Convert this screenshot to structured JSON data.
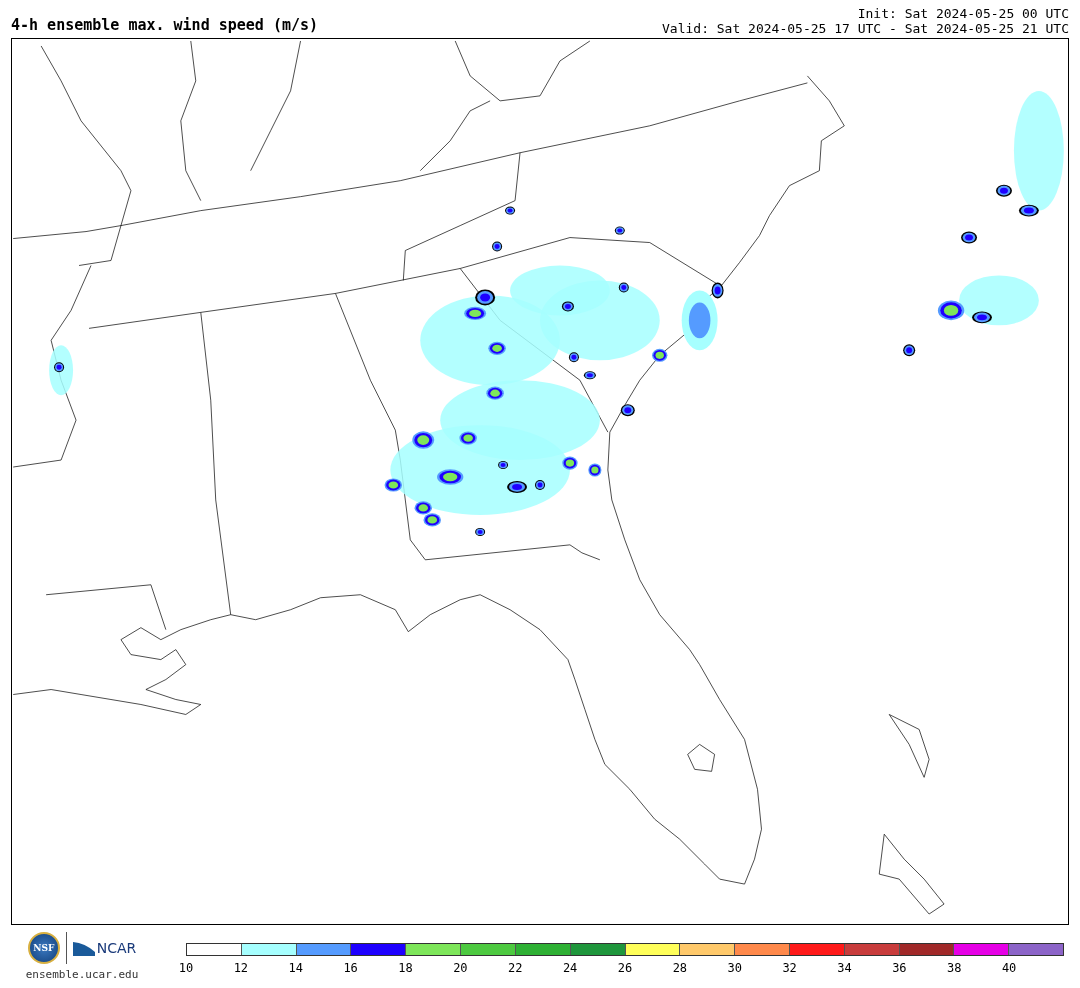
{
  "title": "4-h ensemble max. wind speed (m/s)",
  "init": "Init: Sat 2024-05-25 00 UTC",
  "valid": "Valid: Sat 2024-05-25 17 UTC - Sat 2024-05-25 21 UTC",
  "footer": {
    "nsf_logo_text": "NSF",
    "ncar_logo_text": "NCAR",
    "url": "ensemble.ucar.edu"
  },
  "colorbar": {
    "bins": [
      {
        "color": "#ffffff"
      },
      {
        "color": "#a6ffff"
      },
      {
        "color": "#559bff"
      },
      {
        "color": "#1e00ff"
      },
      {
        "color": "#7ee65a"
      },
      {
        "color": "#4dc940"
      },
      {
        "color": "#2eb034"
      },
      {
        "color": "#1f963c"
      },
      {
        "color": "#ffff5a"
      },
      {
        "color": "#ffc96b"
      },
      {
        "color": "#ff894b"
      },
      {
        "color": "#ff1a1a"
      },
      {
        "color": "#c83c3c"
      },
      {
        "color": "#a02828"
      },
      {
        "color": "#e600e6"
      },
      {
        "color": "#8c64c8"
      }
    ],
    "ticks": [
      "10",
      "12",
      "14",
      "16",
      "18",
      "20",
      "22",
      "24",
      "26",
      "28",
      "30",
      "32",
      "34",
      "36",
      "38",
      "40"
    ]
  }
}
